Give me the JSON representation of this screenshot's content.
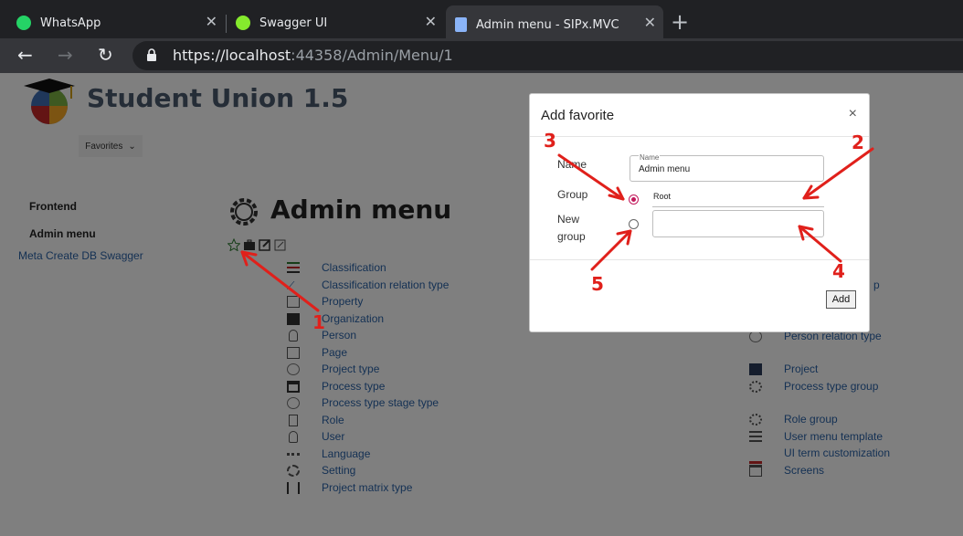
{
  "browser": {
    "tabs": [
      {
        "title": "WhatsApp",
        "icon": "whatsapp-icon"
      },
      {
        "title": "Swagger UI",
        "icon": "swagger-icon"
      },
      {
        "title": "Admin menu - SIPx.MVC",
        "icon": "document-icon",
        "active": true
      }
    ],
    "url_host": "https://localhost",
    "url_rest": ":44358/Admin/Menu/1"
  },
  "site": {
    "brand": "Student Union 1.5",
    "favorites_label": "Favorites",
    "nav": [
      {
        "label": "Frontend"
      },
      {
        "label": "Admin menu"
      }
    ],
    "nav_links": "Meta Create DB Swagger"
  },
  "main": {
    "title": "Admin menu",
    "left_items": [
      {
        "label": "Classification",
        "icon": "list-icon"
      },
      {
        "label": "Classification relation type",
        "icon": "link-icon"
      },
      {
        "label": "Property",
        "icon": "property-icon"
      },
      {
        "label": "Organization",
        "icon": "building-icon"
      },
      {
        "label": "Person",
        "icon": "person-icon"
      },
      {
        "label": "Page",
        "icon": "page-icon"
      },
      {
        "label": "Project type",
        "icon": "atom-icon"
      },
      {
        "label": "Process type",
        "icon": "table-icon"
      },
      {
        "label": "Process type stage type",
        "icon": "atom-icon"
      },
      {
        "label": "Role",
        "icon": "role-icon"
      },
      {
        "label": "User",
        "icon": "user-icon"
      },
      {
        "label": "Language",
        "icon": "language-icon"
      },
      {
        "label": "Setting",
        "icon": "setting-icon"
      },
      {
        "label": "Project matrix type",
        "icon": "matrix-icon"
      }
    ],
    "right_partial": "p",
    "right_items": [
      {
        "label": "Person relation type",
        "icon": "atom-icon"
      },
      {
        "label": "Project",
        "icon": "project-icon"
      },
      {
        "label": "Process type group",
        "icon": "group-icon"
      },
      {
        "label": "Role group",
        "icon": "group-icon"
      },
      {
        "label": "User menu template",
        "icon": "menu-icon"
      },
      {
        "label": "UI term customization",
        "icon": "chart-icon"
      },
      {
        "label": "Screens",
        "icon": "screen-icon"
      }
    ]
  },
  "modal": {
    "title": "Add favorite",
    "close": "×",
    "name_label": "Name",
    "name_float": "Name",
    "name_value": "Admin menu",
    "group_label": "Group",
    "root_value": "Root",
    "new_group_label_1": "New",
    "new_group_label_2": "group",
    "add_label": "Add"
  },
  "annotations": [
    "1",
    "2",
    "3",
    "4",
    "5"
  ],
  "colors": {
    "annotation": "#e0201b",
    "link": "#2a63a8",
    "radio_selected": "#c2185b"
  }
}
